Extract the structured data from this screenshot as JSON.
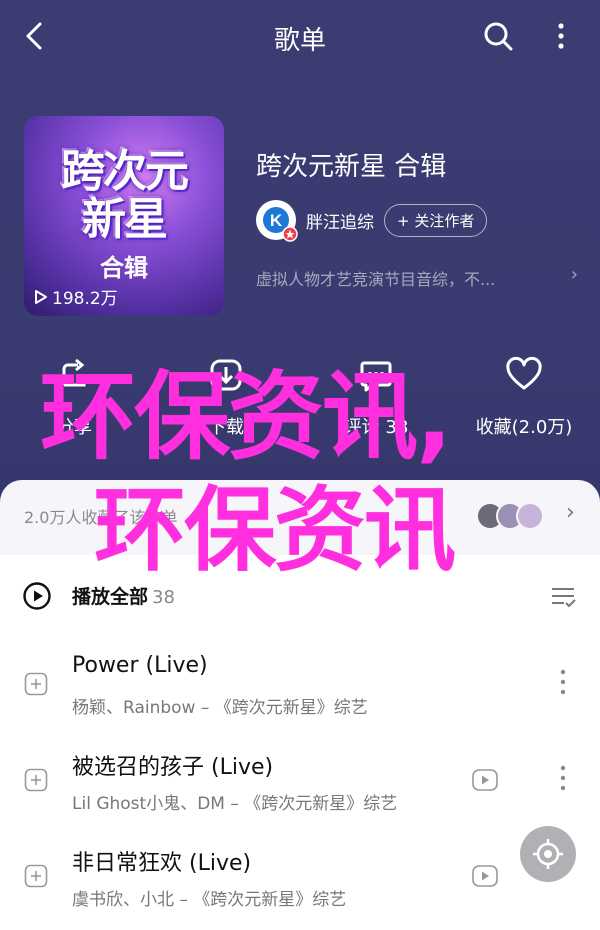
{
  "nav": {
    "title": "歌单"
  },
  "album": {
    "cover_title": "跨次元新星",
    "cover_subtitle": "合辑",
    "play_count": "198.2万",
    "title": "跨次元新星 合辑",
    "author": "胖汪追综",
    "follow_label": "+ 关注作者",
    "description": "虚拟人物才艺竞演节目音综，不..."
  },
  "actions": [
    {
      "label": "分享",
      "icon": "share-icon"
    },
    {
      "label": "下载",
      "icon": "download-icon"
    },
    {
      "label": "评论 38",
      "icon": "comment-icon"
    },
    {
      "label": "收藏(2.0万)",
      "icon": "heart-icon"
    }
  ],
  "collect": {
    "text": "2.0万人收藏了该歌单"
  },
  "playall": {
    "label": "播放全部",
    "count": "38"
  },
  "songs": [
    {
      "title": "Power (Live)",
      "subtitle": "杨颖、Rainbow – 《跨次元新星》综艺",
      "has_mv": false
    },
    {
      "title": "被选召的孩子 (Live)",
      "subtitle": "Lil Ghost小鬼、DM – 《跨次元新星》综艺",
      "has_mv": true
    },
    {
      "title": "非日常狂欢 (Live)",
      "subtitle": "虞书欣、小北 – 《跨次元新星》综艺",
      "has_mv": true
    }
  ],
  "watermark": {
    "line1": "环保资讯,",
    "line2": "环保资讯"
  },
  "colors": {
    "header_bg": "#3b3d72",
    "watermark": "#ff2fe0"
  }
}
